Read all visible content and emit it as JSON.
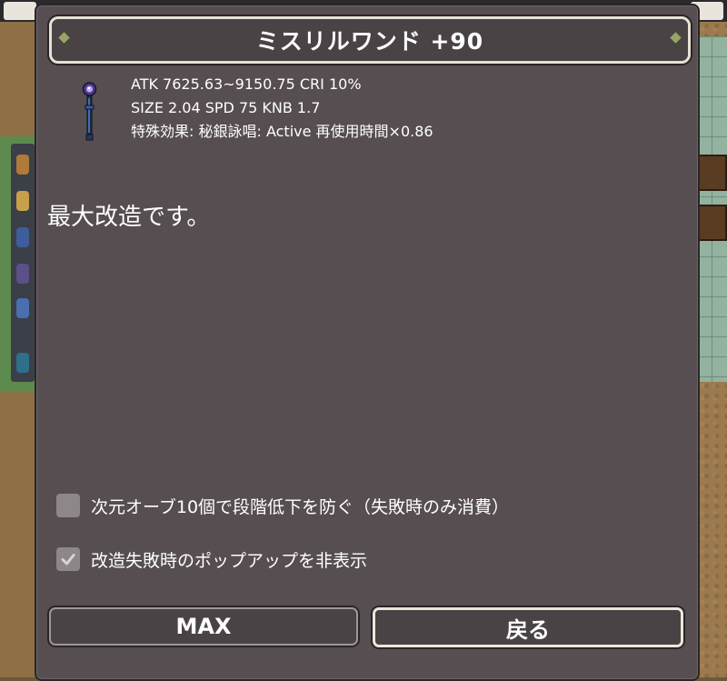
{
  "dialog": {
    "title": "ミスリルワンド +90",
    "item_icon": "wand-icon",
    "stats": {
      "line1": "ATK 7625.63~9150.75  CRI 10%",
      "line2": "SIZE 2.04  SPD 75  KNB 1.7",
      "line3": "特殊効果: 秘銀詠唱: Active 再使用時間×0.86"
    },
    "message": "最大改造です。",
    "options": [
      {
        "label": "次元オーブ10個で段階低下を防ぐ（失敗時のみ消費）",
        "checked": false
      },
      {
        "label": "改造失敗時のポップアップを非表示",
        "checked": true
      }
    ],
    "buttons": {
      "max_label": "MAX",
      "back_label": "戻る"
    }
  },
  "colors": {
    "panel": "#564e50",
    "title_bg": "#4a4345",
    "border_light": "#e8e2d4",
    "checkbox": "#8d8789",
    "text": "#ffffff"
  }
}
